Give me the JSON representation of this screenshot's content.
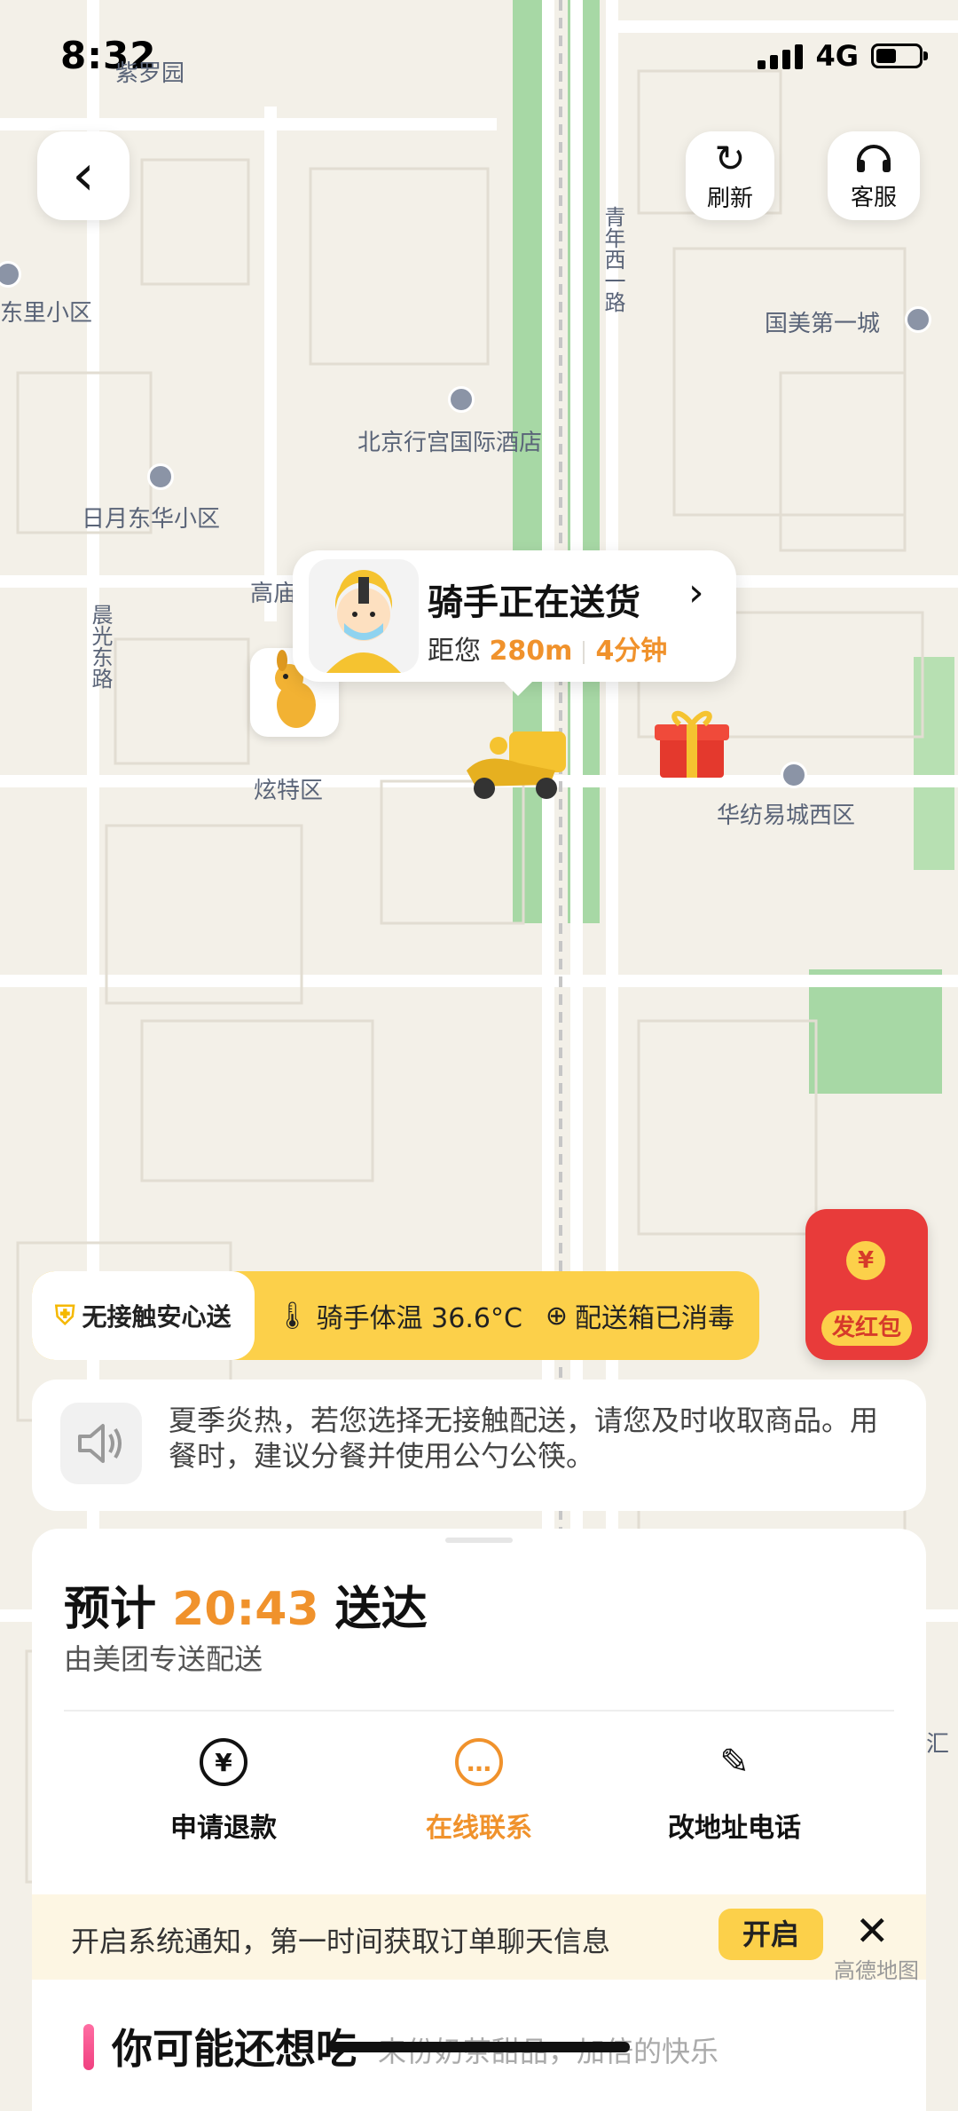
{
  "status": {
    "time": "8:32",
    "network": "4G"
  },
  "toolbar": {
    "refresh_label": "刷新",
    "service_label": "客服"
  },
  "map": {
    "labels": [
      "紫罗园",
      "东里小区",
      "北京行宫国际酒店",
      "日月东华小区",
      "高庙",
      "晨光东路",
      "炫特区",
      "青年西一路",
      "国美第一城",
      "华纺易城西区",
      "汇"
    ],
    "attribution": "高德地图"
  },
  "rider": {
    "title": "骑手正在送货",
    "prefix": "距您",
    "distance": "280m",
    "eta": "4分钟"
  },
  "safety": {
    "badge": "无接触安心送",
    "temp": "骑手体温 36.6°C",
    "box": "配送箱已消毒"
  },
  "red_packet": {
    "label": "发红包",
    "coin": "¥"
  },
  "notice": {
    "text": "夏季炎热，若您选择无接触配送，请您及时收取商品。用餐时，建议分餐并使用公勺公筷。"
  },
  "order": {
    "eta_prefix": "预计",
    "eta_time": "20:43",
    "eta_suffix": "送达",
    "courier": "由美团专送配送",
    "actions": [
      {
        "label": "申请退款",
        "icon": "refund-icon"
      },
      {
        "label": "在线联系",
        "icon": "chat-icon"
      },
      {
        "label": "改地址电话",
        "icon": "edit-icon"
      }
    ]
  },
  "notify": {
    "text": "开启系统通知，第一时间获取订单聊天信息",
    "button": "开启"
  },
  "recommend": {
    "title": "你可能还想吃",
    "subtitle": "来份奶茶甜品，加倍的快乐"
  },
  "colors": {
    "accent": "#f0922c",
    "yellow": "#fcd04a",
    "red": "#e83b3a"
  }
}
